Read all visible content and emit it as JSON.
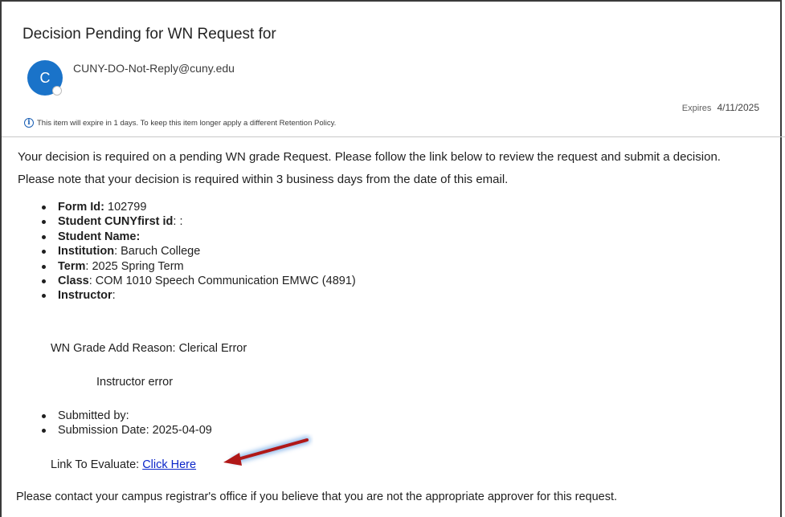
{
  "email": {
    "subject": "Decision Pending for WN Request for",
    "sender": "CUNY-DO-Not-Reply@cuny.edu",
    "avatar_initial": "C",
    "avatar_color": "#1a73c9",
    "expires_label": "Expires",
    "expires_date": "4/11/2025",
    "retention_notice": "This item will expire in 1 days. To keep this item longer apply a different Retention Policy."
  },
  "body": {
    "line1": "Your decision is required on a pending WN grade Request. Please follow the link below to review the request and submit a decision.",
    "line2": "Please note that your decision is required within 3 business days from the date of this email.",
    "fields": [
      {
        "label": "Form Id:",
        "value": " 102799"
      },
      {
        "label": "Student CUNYfirst id",
        "value": ": :"
      },
      {
        "label": "Student Name",
        "value": ":"
      },
      {
        "label": "Institution",
        "value": ": Baruch College"
      },
      {
        "label": "Term",
        "value": ": 2025 Spring Term"
      },
      {
        "label": "Class",
        "value": ": COM 1010 Speech Communication EMWC (4891)"
      },
      {
        "label": "Instructor",
        "value": ":"
      }
    ],
    "reason": "WN Grade Add Reason: Clerical Error",
    "reason_detail": "Instructor error",
    "submitted_by": "Submitted by:",
    "submission_date": "Submission Date: 2025-04-09",
    "link_label": "Link To Evaluate: ",
    "link_text": "Click Here",
    "footer": "Please contact your campus registrar's office if you believe that you are not the appropriate approver for this request."
  },
  "annotation": {
    "arrow_color": "#b01818",
    "glow_color": "#7fb0e8"
  }
}
